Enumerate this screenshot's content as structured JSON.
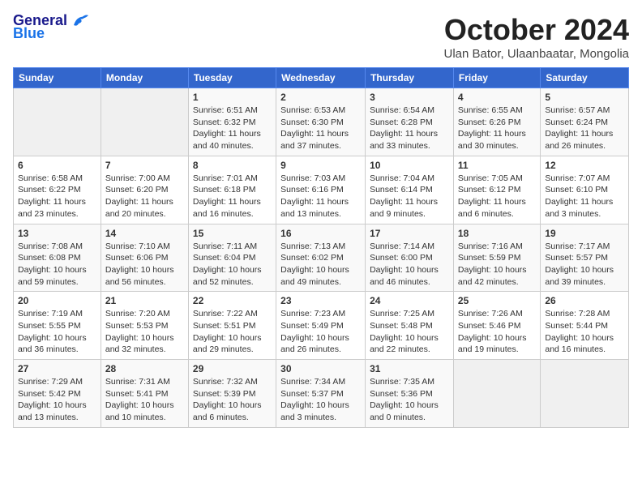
{
  "header": {
    "logo_general": "General",
    "logo_blue": "Blue",
    "month_title": "October 2024",
    "subtitle": "Ulan Bator, Ulaanbaatar, Mongolia"
  },
  "days_of_week": [
    "Sunday",
    "Monday",
    "Tuesday",
    "Wednesday",
    "Thursday",
    "Friday",
    "Saturday"
  ],
  "weeks": [
    [
      {
        "day": "",
        "info": ""
      },
      {
        "day": "",
        "info": ""
      },
      {
        "day": "1",
        "info": "Sunrise: 6:51 AM\nSunset: 6:32 PM\nDaylight: 11 hours and 40 minutes."
      },
      {
        "day": "2",
        "info": "Sunrise: 6:53 AM\nSunset: 6:30 PM\nDaylight: 11 hours and 37 minutes."
      },
      {
        "day": "3",
        "info": "Sunrise: 6:54 AM\nSunset: 6:28 PM\nDaylight: 11 hours and 33 minutes."
      },
      {
        "day": "4",
        "info": "Sunrise: 6:55 AM\nSunset: 6:26 PM\nDaylight: 11 hours and 30 minutes."
      },
      {
        "day": "5",
        "info": "Sunrise: 6:57 AM\nSunset: 6:24 PM\nDaylight: 11 hours and 26 minutes."
      }
    ],
    [
      {
        "day": "6",
        "info": "Sunrise: 6:58 AM\nSunset: 6:22 PM\nDaylight: 11 hours and 23 minutes."
      },
      {
        "day": "7",
        "info": "Sunrise: 7:00 AM\nSunset: 6:20 PM\nDaylight: 11 hours and 20 minutes."
      },
      {
        "day": "8",
        "info": "Sunrise: 7:01 AM\nSunset: 6:18 PM\nDaylight: 11 hours and 16 minutes."
      },
      {
        "day": "9",
        "info": "Sunrise: 7:03 AM\nSunset: 6:16 PM\nDaylight: 11 hours and 13 minutes."
      },
      {
        "day": "10",
        "info": "Sunrise: 7:04 AM\nSunset: 6:14 PM\nDaylight: 11 hours and 9 minutes."
      },
      {
        "day": "11",
        "info": "Sunrise: 7:05 AM\nSunset: 6:12 PM\nDaylight: 11 hours and 6 minutes."
      },
      {
        "day": "12",
        "info": "Sunrise: 7:07 AM\nSunset: 6:10 PM\nDaylight: 11 hours and 3 minutes."
      }
    ],
    [
      {
        "day": "13",
        "info": "Sunrise: 7:08 AM\nSunset: 6:08 PM\nDaylight: 10 hours and 59 minutes."
      },
      {
        "day": "14",
        "info": "Sunrise: 7:10 AM\nSunset: 6:06 PM\nDaylight: 10 hours and 56 minutes."
      },
      {
        "day": "15",
        "info": "Sunrise: 7:11 AM\nSunset: 6:04 PM\nDaylight: 10 hours and 52 minutes."
      },
      {
        "day": "16",
        "info": "Sunrise: 7:13 AM\nSunset: 6:02 PM\nDaylight: 10 hours and 49 minutes."
      },
      {
        "day": "17",
        "info": "Sunrise: 7:14 AM\nSunset: 6:00 PM\nDaylight: 10 hours and 46 minutes."
      },
      {
        "day": "18",
        "info": "Sunrise: 7:16 AM\nSunset: 5:59 PM\nDaylight: 10 hours and 42 minutes."
      },
      {
        "day": "19",
        "info": "Sunrise: 7:17 AM\nSunset: 5:57 PM\nDaylight: 10 hours and 39 minutes."
      }
    ],
    [
      {
        "day": "20",
        "info": "Sunrise: 7:19 AM\nSunset: 5:55 PM\nDaylight: 10 hours and 36 minutes."
      },
      {
        "day": "21",
        "info": "Sunrise: 7:20 AM\nSunset: 5:53 PM\nDaylight: 10 hours and 32 minutes."
      },
      {
        "day": "22",
        "info": "Sunrise: 7:22 AM\nSunset: 5:51 PM\nDaylight: 10 hours and 29 minutes."
      },
      {
        "day": "23",
        "info": "Sunrise: 7:23 AM\nSunset: 5:49 PM\nDaylight: 10 hours and 26 minutes."
      },
      {
        "day": "24",
        "info": "Sunrise: 7:25 AM\nSunset: 5:48 PM\nDaylight: 10 hours and 22 minutes."
      },
      {
        "day": "25",
        "info": "Sunrise: 7:26 AM\nSunset: 5:46 PM\nDaylight: 10 hours and 19 minutes."
      },
      {
        "day": "26",
        "info": "Sunrise: 7:28 AM\nSunset: 5:44 PM\nDaylight: 10 hours and 16 minutes."
      }
    ],
    [
      {
        "day": "27",
        "info": "Sunrise: 7:29 AM\nSunset: 5:42 PM\nDaylight: 10 hours and 13 minutes."
      },
      {
        "day": "28",
        "info": "Sunrise: 7:31 AM\nSunset: 5:41 PM\nDaylight: 10 hours and 10 minutes."
      },
      {
        "day": "29",
        "info": "Sunrise: 7:32 AM\nSunset: 5:39 PM\nDaylight: 10 hours and 6 minutes."
      },
      {
        "day": "30",
        "info": "Sunrise: 7:34 AM\nSunset: 5:37 PM\nDaylight: 10 hours and 3 minutes."
      },
      {
        "day": "31",
        "info": "Sunrise: 7:35 AM\nSunset: 5:36 PM\nDaylight: 10 hours and 0 minutes."
      },
      {
        "day": "",
        "info": ""
      },
      {
        "day": "",
        "info": ""
      }
    ]
  ]
}
